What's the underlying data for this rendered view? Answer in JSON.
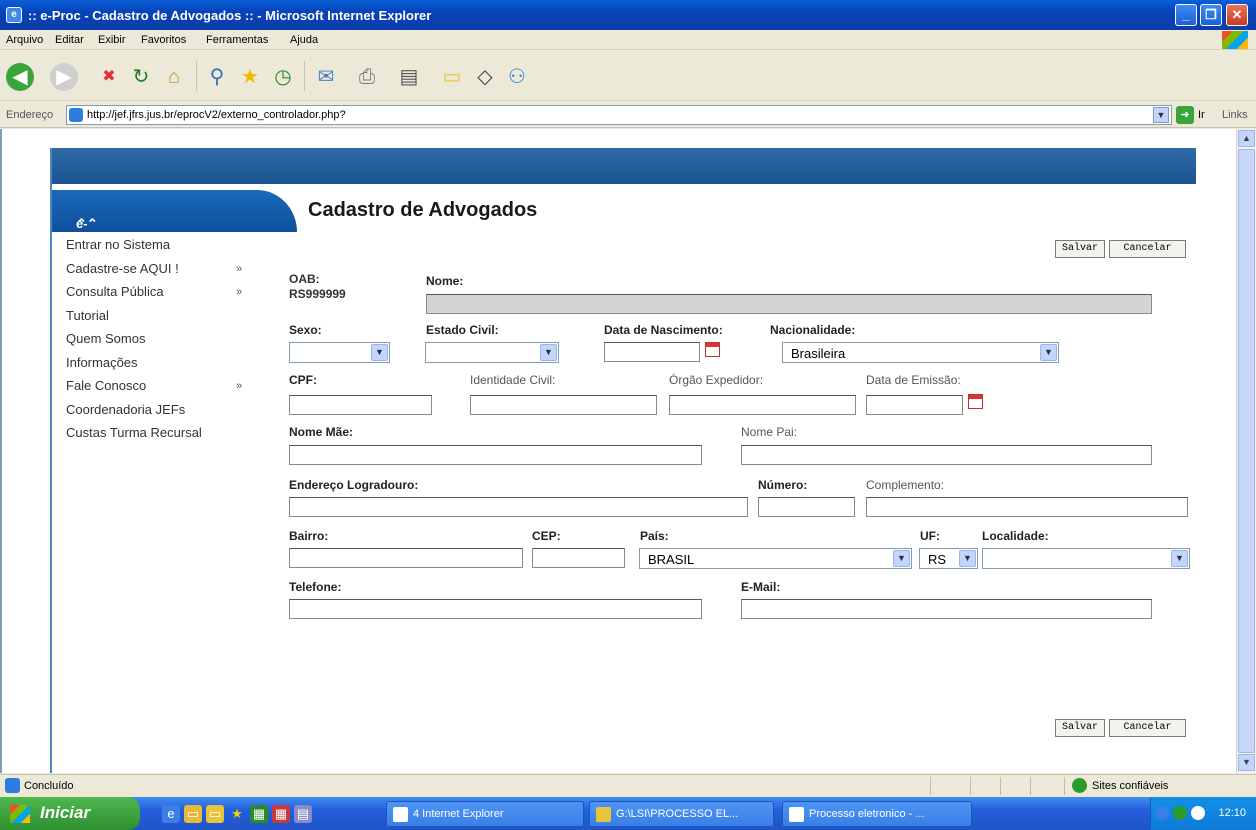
{
  "window": {
    "title": ":: e-Proc - Cadastro de Advogados :: - Microsoft Internet Explorer"
  },
  "menu": {
    "items": [
      "Arquivo",
      "Editar",
      "Exibir",
      "Favoritos",
      "Ferramentas",
      "Ajuda"
    ]
  },
  "address": {
    "label": "Endereço",
    "url": "http://jef.jfrs.jus.br/eprocV2/externo_controlador.php?",
    "go_label": "Ir",
    "links_label": "Links"
  },
  "sidebar": {
    "header": "e-Proc",
    "header_icon": "double-chevron-up",
    "items": [
      {
        "label": "Entrar no Sistema",
        "arrow": ""
      },
      {
        "label": "Cadastre-se AQUI !",
        "arrow": "»"
      },
      {
        "label": "Consulta Pública",
        "arrow": "»"
      },
      {
        "label": "Tutorial",
        "arrow": ""
      },
      {
        "label": "Quem Somos",
        "arrow": ""
      },
      {
        "label": "Informações",
        "arrow": ""
      },
      {
        "label": "Fale Conosco",
        "arrow": "»"
      },
      {
        "label": "Coordenadoria JEFs",
        "arrow": ""
      },
      {
        "label": "Custas Turma Recursal",
        "arrow": ""
      }
    ]
  },
  "form": {
    "title": "Cadastro de Advogados",
    "save_label": "Salvar",
    "cancel_label": "Cancelar",
    "oab_label": "OAB:",
    "oab_value": "RS999999",
    "nome_label": "Nome:",
    "nome_value": "",
    "sexo_label": "Sexo:",
    "sexo_value": "",
    "estado_civil_label": "Estado Civil:",
    "estado_civil_value": "",
    "data_nasc_label": "Data de Nascimento:",
    "nacionalidade_label": "Nacionalidade:",
    "nacionalidade_value": "Brasileira",
    "cpf_label": "CPF:",
    "identidade_label": "Identidade Civil:",
    "orgao_label": "Órgão Expedidor:",
    "data_emissao_label": "Data de Emissão:",
    "nome_mae_label": "Nome Mãe:",
    "nome_pai_label": "Nome Pai:",
    "endereco_label": "Endereço Logradouro:",
    "numero_label": "Número:",
    "complemento_label": "Complemento:",
    "bairro_label": "Bairro:",
    "cep_label": "CEP:",
    "pais_label": "País:",
    "pais_value": "BRASIL",
    "uf_label": "UF:",
    "uf_value": "RS",
    "localidade_label": "Localidade:",
    "localidade_value": "",
    "telefone_label": "Telefone:",
    "email_label": "E-Mail:"
  },
  "status": {
    "text": "Concluído",
    "zone": "Sites confiáveis"
  },
  "taskbar": {
    "start_label": "Iniciar",
    "tasks": [
      {
        "label": "4 Internet Explorer"
      },
      {
        "label": "G:\\LSI\\PROCESSO EL..."
      },
      {
        "label": "Processo eletronico - ..."
      }
    ],
    "clock": "12:10"
  },
  "colors": {
    "accent_blue": "#1a5390",
    "sidebar_header": "#1b6ab8",
    "titlebar": "#0842b8"
  }
}
